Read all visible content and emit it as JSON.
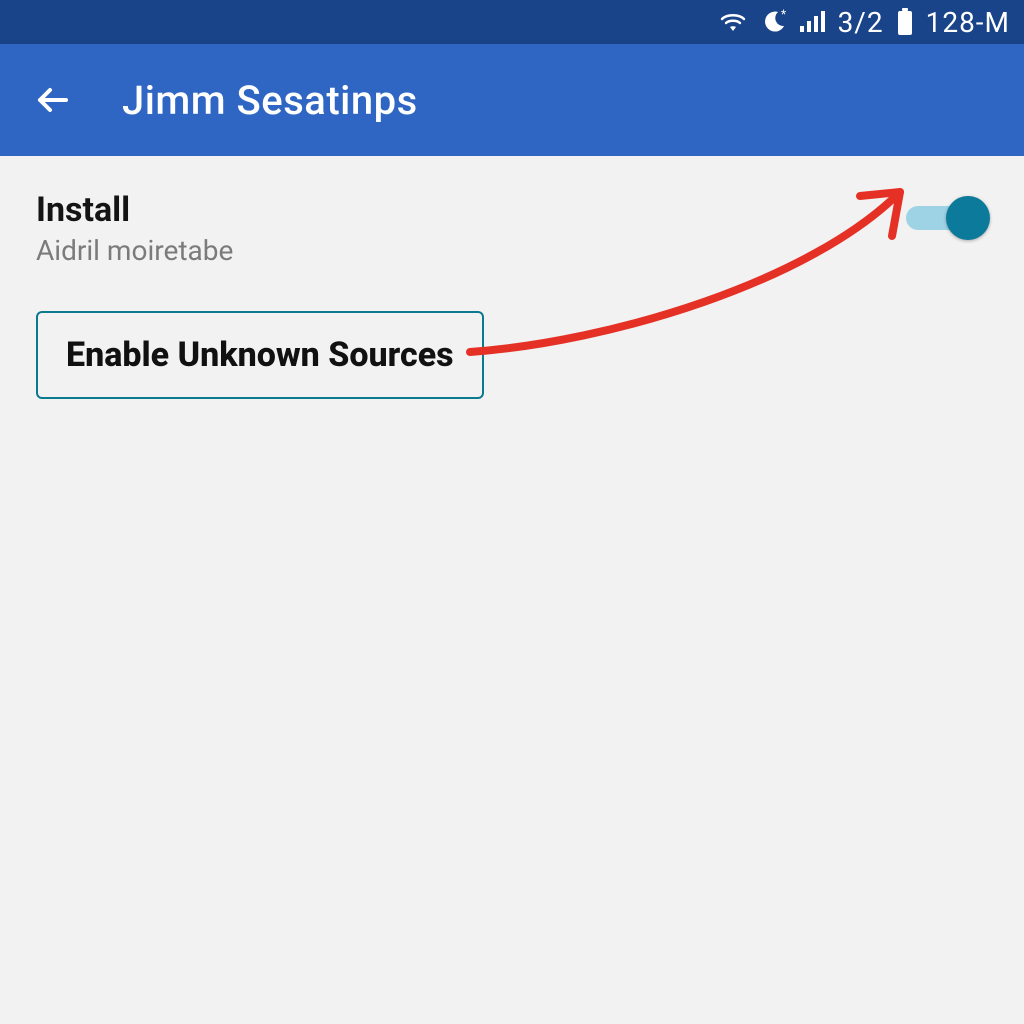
{
  "status_bar": {
    "sim_text": "3/2",
    "right_text": "128-M"
  },
  "app_bar": {
    "title": "Jimm Sesatinps"
  },
  "setting": {
    "title": "Install",
    "subtitle": "Aidril moiretabe",
    "toggle_on": true
  },
  "callout": {
    "label": "Enable Unknown Sources"
  },
  "colors": {
    "status_bg": "#1a4489",
    "appbar_bg": "#2f66c4",
    "toggle_thumb": "#0b7a9b",
    "toggle_track": "#9ed3e6",
    "arrow": "#e53125"
  }
}
